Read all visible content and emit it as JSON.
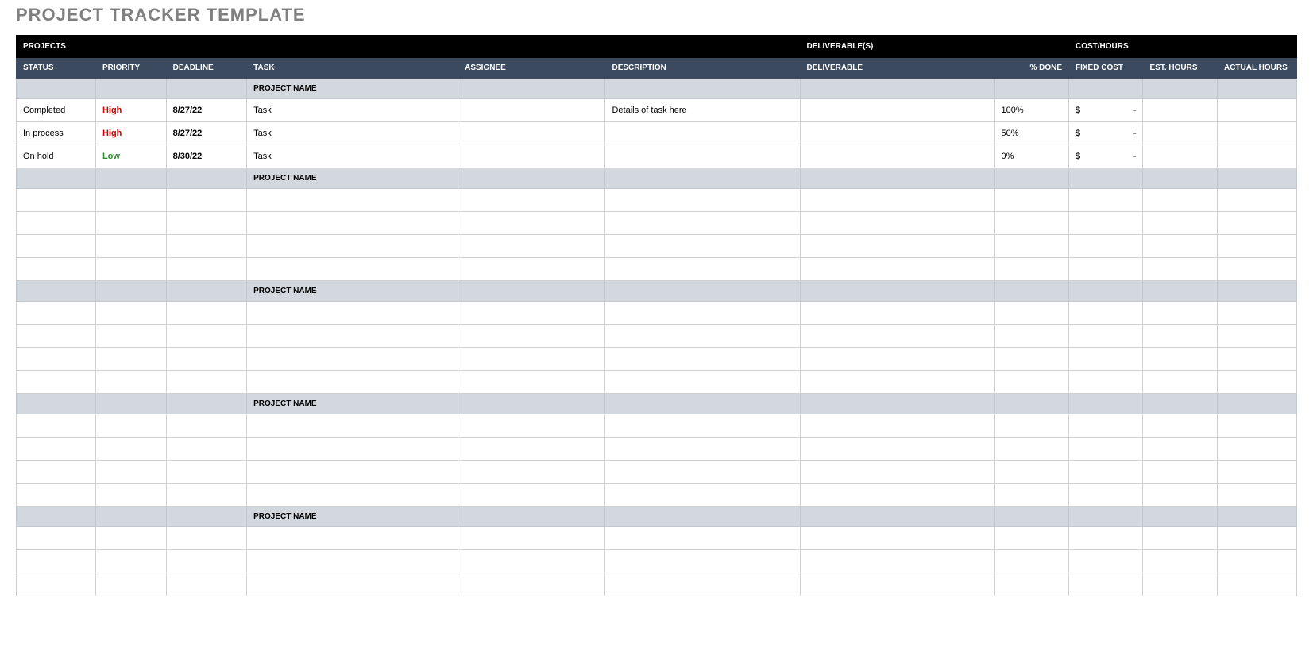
{
  "title": "PROJECT TRACKER TEMPLATE",
  "band": {
    "projects": "PROJECTS",
    "deliverables": "DELIVERABLE(S)",
    "costhours": "COST/HOURS"
  },
  "headers": {
    "status": "STATUS",
    "priority": "PRIORITY",
    "deadline": "DEADLINE",
    "task": "TASK",
    "assignee": "ASSIGNEE",
    "description": "DESCRIPTION",
    "deliverable": "DELIVERABLE",
    "pct_done": "% DONE",
    "fixed_cost": "FIXED COST",
    "est_hours": "EST. HOURS",
    "actual_hours": "ACTUAL HOURS"
  },
  "group_label": "PROJECT NAME",
  "currency": "$",
  "dash": "-",
  "groups": [
    {
      "name": "PROJECT NAME",
      "rows": [
        {
          "status": "Completed",
          "priority": "High",
          "priority_class": "prio-high",
          "deadline": "8/27/22",
          "task": "Task",
          "assignee": "",
          "description": "Details of task here",
          "deliverable": "",
          "pct_done": "100%",
          "fixed_cost": "$ -",
          "est_hours": "",
          "actual_hours": ""
        },
        {
          "status": "In process",
          "priority": "High",
          "priority_class": "prio-high",
          "deadline": "8/27/22",
          "task": "Task",
          "assignee": "",
          "description": "",
          "deliverable": "",
          "pct_done": "50%",
          "fixed_cost": "$ -",
          "est_hours": "",
          "actual_hours": ""
        },
        {
          "status": "On hold",
          "priority": "Low",
          "priority_class": "prio-low",
          "deadline": "8/30/22",
          "task": "Task",
          "assignee": "",
          "description": "",
          "deliverable": "",
          "pct_done": "0%",
          "fixed_cost": "$ -",
          "est_hours": "",
          "actual_hours": ""
        }
      ]
    },
    {
      "name": "PROJECT NAME",
      "rows": [
        {},
        {},
        {},
        {}
      ]
    },
    {
      "name": "PROJECT NAME",
      "rows": [
        {},
        {},
        {},
        {}
      ]
    },
    {
      "name": "PROJECT NAME",
      "rows": [
        {},
        {},
        {},
        {}
      ]
    },
    {
      "name": "PROJECT NAME",
      "rows": [
        {},
        {},
        {}
      ]
    }
  ]
}
